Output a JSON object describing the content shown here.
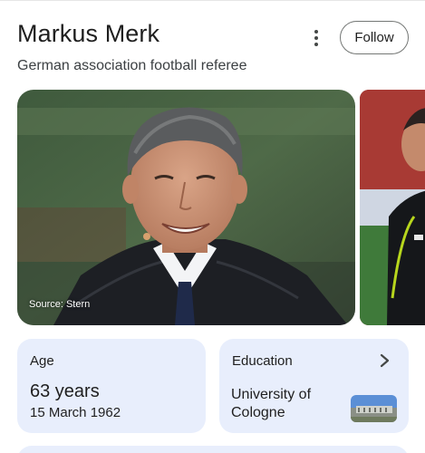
{
  "header": {
    "title": "Markus Merk",
    "subtitle": "German association football referee",
    "follow_label": "Follow",
    "more_icon": "more-vert-icon"
  },
  "carousel": {
    "source_label": "Source: Stern"
  },
  "cards": {
    "age": {
      "heading": "Age",
      "value": "63 years",
      "date": "15 March 1962"
    },
    "education": {
      "heading": "Education",
      "value": "University of Cologne",
      "chevron_icon": "chevron-right-icon"
    }
  },
  "colors": {
    "card_background": "#e8eefc",
    "text_primary": "#1f1f1f",
    "button_border": "#747775"
  }
}
